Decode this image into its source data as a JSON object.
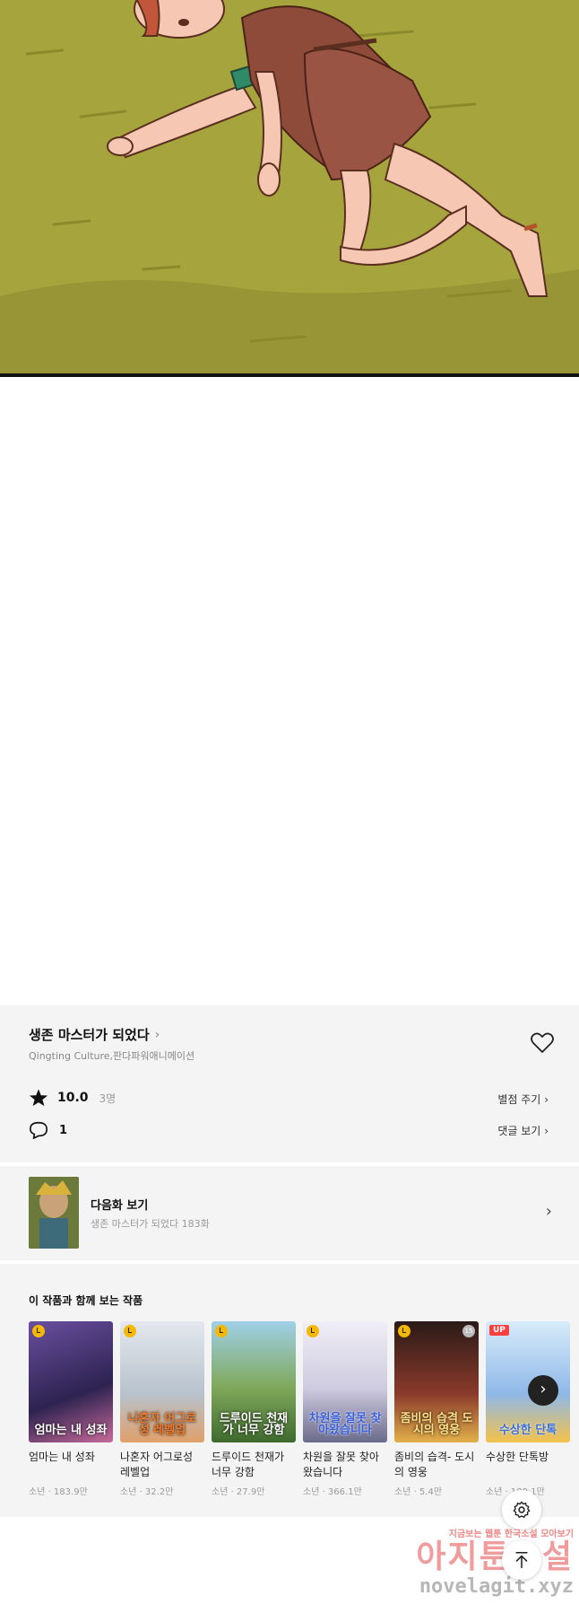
{
  "series": {
    "title": "생존 마스터가 되었다",
    "authors": "Qingting Culture,판다파워애니메이션",
    "rating": "10.0",
    "raters": "3명",
    "rate_link": "별점 주기",
    "comment_count": "1",
    "comment_link": "댓글 보기"
  },
  "next_episode": {
    "label": "다음화 보기",
    "subtitle": "생존 마스터가 되었다 183화"
  },
  "recommendations": {
    "title": "이 작품과 함께 보는 작품",
    "items": [
      {
        "title": "엄마는 내 성좌",
        "meta": "소년 · 183.9만",
        "cover_text": "엄마는 내 성좌",
        "badge": "clock",
        "color": "#4a3a6e"
      },
      {
        "title": "나혼자 어그로성 레벨업",
        "meta": "소년 · 32.2만",
        "cover_text": "나혼자 어그로성 레벨업",
        "badge": "clock",
        "color": "#c9cfd6"
      },
      {
        "title": "드루이드 천재가 너무 강함",
        "meta": "소년 · 27.9만",
        "cover_text": "드루이드 천재가 너무 강함",
        "badge": "clock",
        "color": "#7fa85a"
      },
      {
        "title": "차원을 잘못 찾아왔습니다",
        "meta": "소년 · 366.1만",
        "cover_text": "차원을 잘못 찾아왔습니다",
        "badge": "clock",
        "color": "#d7d4e2"
      },
      {
        "title": "좀비의 습격- 도시의 영웅",
        "meta": "소년 · 5.4만",
        "cover_text": "좀비의 습격 도시의 영웅",
        "badge": "clock",
        "number": "15",
        "color": "#8a3a2a"
      },
      {
        "title": "수상한 단톡방",
        "meta": "소년 · 180.1만",
        "cover_text": "수상한 단톡",
        "badge": "UP",
        "color": "#8fb8e8"
      }
    ]
  },
  "watermark": {
    "line1": "지금보는 웹툰 한국소설 모아보기",
    "line2": "아지툰소설",
    "line3": "novelagit.xyz"
  },
  "colors": {
    "grass": "#a6a43c",
    "panel_bg": "#f4f4f4"
  },
  "icons": [
    "heart-icon",
    "star-icon",
    "comment-icon",
    "chevron-right-icon",
    "settings-icon",
    "arrow-up-icon",
    "clock-badge-icon"
  ]
}
